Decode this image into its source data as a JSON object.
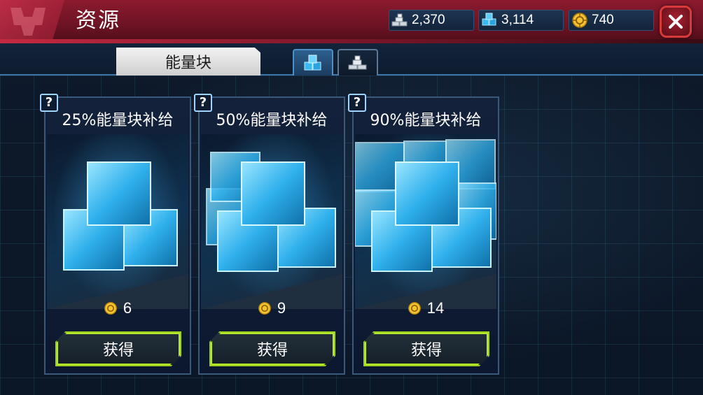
{
  "header": {
    "title": "资源",
    "currencies": [
      {
        "icon": "alloy-icon",
        "value": "2,370"
      },
      {
        "icon": "energon-cube-icon",
        "value": "3,114"
      },
      {
        "icon": "gold-coin-icon",
        "value": "740"
      }
    ],
    "close_icon": "close-icon"
  },
  "tabs": {
    "active_label": "能量块",
    "icon_tabs": [
      {
        "icon": "energon-cube-icon",
        "active": true
      },
      {
        "icon": "alloy-icon",
        "active": false
      }
    ]
  },
  "offers": [
    {
      "help": "?",
      "title": "25%能量块补给",
      "price_icon": "gold-coin-icon",
      "price": "6",
      "button": "获得"
    },
    {
      "help": "?",
      "title": "50%能量块补给",
      "price_icon": "gold-coin-icon",
      "price": "9",
      "button": "获得"
    },
    {
      "help": "?",
      "title": "90%能量块补给",
      "price_icon": "gold-coin-icon",
      "price": "14",
      "button": "获得"
    }
  ],
  "colors": {
    "header_red": "#8c1a2e",
    "button_green": "#9ed21f",
    "cube_blue": "#39b7f0",
    "coin_gold": "#f3c331"
  }
}
